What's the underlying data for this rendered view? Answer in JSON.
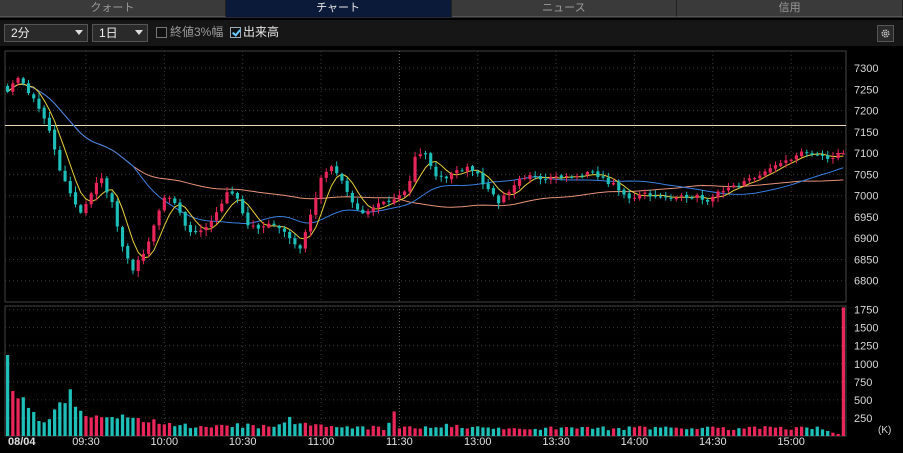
{
  "tabs": [
    {
      "label": "クォート",
      "active": false
    },
    {
      "label": "チャート",
      "active": true
    },
    {
      "label": "ニュース",
      "active": false
    },
    {
      "label": "信用",
      "active": false
    }
  ],
  "toolbar": {
    "interval": "2分",
    "period": "1日",
    "option1": {
      "label": "終値3%幅",
      "checked": false
    },
    "option2": {
      "label": "出来高",
      "checked": true
    }
  },
  "colors": {
    "up": "#e8265a",
    "down": "#1dbfb8",
    "ma_short": "#e8d03a",
    "ma_mid": "#3a7fe0",
    "ma_long": "#e8927a",
    "ref_line": "#e8d8b8",
    "grid": "#3a3a3a"
  },
  "chart_data": [
    {
      "type": "candlestick",
      "title": "",
      "ylim": [
        6750,
        7340
      ],
      "y_ticks": [
        "7300",
        "7250",
        "7200",
        "7150",
        "7100",
        "7050",
        "7000",
        "6950",
        "6900",
        "6850",
        "6800"
      ],
      "x_ticks": [
        "08/04",
        "09:30",
        "10:00",
        "10:30",
        "11:00",
        "11:30",
        "13:00",
        "13:30",
        "14:00",
        "14:30",
        "15:00"
      ],
      "reference_line": 7165,
      "close_anchors": [
        [
          0,
          7250
        ],
        [
          2,
          7280
        ],
        [
          4,
          7240
        ],
        [
          6,
          7210
        ],
        [
          8,
          7150
        ],
        [
          10,
          7060
        ],
        [
          12,
          7000
        ],
        [
          14,
          6960
        ],
        [
          16,
          7010
        ],
        [
          18,
          7040
        ],
        [
          20,
          6980
        ],
        [
          22,
          6880
        ],
        [
          24,
          6830
        ],
        [
          26,
          6860
        ],
        [
          28,
          6930
        ],
        [
          30,
          7000
        ],
        [
          32,
          6980
        ],
        [
          34,
          6930
        ],
        [
          36,
          6910
        ],
        [
          38,
          6930
        ],
        [
          40,
          6960
        ],
        [
          42,
          7010
        ],
        [
          44,
          6990
        ],
        [
          46,
          6930
        ],
        [
          48,
          6920
        ],
        [
          50,
          6940
        ],
        [
          52,
          6920
        ],
        [
          54,
          6900
        ],
        [
          56,
          6880
        ],
        [
          58,
          6960
        ],
        [
          60,
          7040
        ],
        [
          62,
          7070
        ],
        [
          64,
          7030
        ],
        [
          66,
          6980
        ],
        [
          68,
          6960
        ],
        [
          70,
          6970
        ],
        [
          72,
          6990
        ],
        [
          74,
          6990
        ],
        [
          76,
          7005
        ],
        [
          77,
          7040
        ],
        [
          78,
          7090
        ],
        [
          80,
          7100
        ],
        [
          82,
          7050
        ],
        [
          84,
          7040
        ],
        [
          86,
          7060
        ],
        [
          88,
          7070
        ],
        [
          90,
          7050
        ],
        [
          92,
          7010
        ],
        [
          94,
          6985
        ],
        [
          96,
          7010
        ],
        [
          98,
          7040
        ],
        [
          100,
          7045
        ],
        [
          102,
          7040
        ],
        [
          104,
          7040
        ],
        [
          106,
          7045
        ],
        [
          108,
          7040
        ],
        [
          110,
          7050
        ],
        [
          112,
          7050
        ],
        [
          114,
          7040
        ],
        [
          116,
          7025
        ],
        [
          118,
          7000
        ],
        [
          120,
          6995
        ],
        [
          122,
          7005
        ],
        [
          124,
          7000
        ],
        [
          126,
          6995
        ],
        [
          128,
          6990
        ],
        [
          130,
          7000
        ],
        [
          132,
          7000
        ],
        [
          134,
          6990
        ],
        [
          136,
          7010
        ],
        [
          138,
          7020
        ],
        [
          140,
          7020
        ],
        [
          142,
          7040
        ],
        [
          144,
          7050
        ],
        [
          146,
          7060
        ],
        [
          148,
          7075
        ],
        [
          150,
          7090
        ],
        [
          152,
          7100
        ],
        [
          154,
          7095
        ],
        [
          156,
          7090
        ],
        [
          158,
          7090
        ],
        [
          160,
          7095
        ]
      ],
      "volume": {
        "ylim": [
          0,
          1800
        ],
        "y_ticks": [
          "1750",
          "1500",
          "1250",
          "1000",
          "750",
          "500",
          "250"
        ],
        "unit": "(K)",
        "anchors": [
          [
            0,
            950
          ],
          [
            1,
            700
          ],
          [
            2,
            500
          ],
          [
            3,
            480
          ],
          [
            4,
            430
          ],
          [
            5,
            300
          ],
          [
            6,
            260
          ],
          [
            7,
            250
          ],
          [
            8,
            280
          ],
          [
            9,
            320
          ],
          [
            10,
            380
          ],
          [
            11,
            420
          ],
          [
            12,
            550
          ],
          [
            13,
            350
          ],
          [
            14,
            300
          ],
          [
            15,
            280
          ],
          [
            16,
            250
          ],
          [
            17,
            250
          ],
          [
            18,
            260
          ],
          [
            20,
            240
          ],
          [
            22,
            250
          ],
          [
            24,
            280
          ],
          [
            26,
            220
          ],
          [
            28,
            200
          ],
          [
            30,
            160
          ],
          [
            32,
            150
          ],
          [
            34,
            150
          ],
          [
            36,
            140
          ],
          [
            38,
            140
          ],
          [
            40,
            160
          ],
          [
            42,
            140
          ],
          [
            44,
            150
          ],
          [
            46,
            140
          ],
          [
            48,
            140
          ],
          [
            50,
            130
          ],
          [
            52,
            170
          ],
          [
            54,
            250
          ],
          [
            56,
            160
          ],
          [
            58,
            140
          ],
          [
            60,
            150
          ],
          [
            62,
            130
          ],
          [
            64,
            120
          ],
          [
            66,
            120
          ],
          [
            68,
            110
          ],
          [
            70,
            120
          ],
          [
            72,
            110
          ],
          [
            74,
            300
          ],
          [
            75,
            120
          ],
          [
            76,
            110
          ],
          [
            78,
            110
          ],
          [
            80,
            110
          ],
          [
            84,
            140
          ],
          [
            88,
            110
          ],
          [
            92,
            110
          ],
          [
            96,
            110
          ],
          [
            100,
            110
          ],
          [
            104,
            110
          ],
          [
            108,
            110
          ],
          [
            112,
            120
          ],
          [
            116,
            100
          ],
          [
            120,
            110
          ],
          [
            124,
            110
          ],
          [
            128,
            110
          ],
          [
            132,
            110
          ],
          [
            136,
            110
          ],
          [
            140,
            110
          ],
          [
            144,
            120
          ],
          [
            148,
            110
          ],
          [
            152,
            110
          ],
          [
            156,
            110
          ],
          [
            159,
            30
          ],
          [
            160,
            1780
          ]
        ]
      }
    }
  ]
}
